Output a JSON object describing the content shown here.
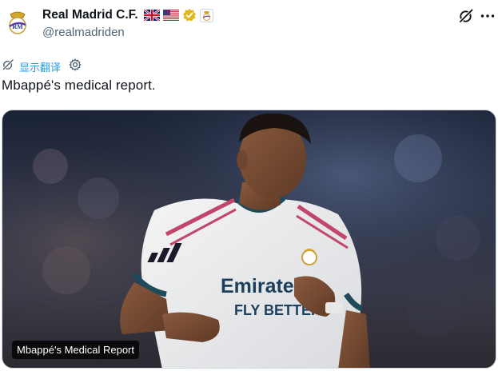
{
  "post": {
    "author": {
      "display_name": "Real Madrid C.F.",
      "handle": "@realmadriden",
      "avatar_icon": "real-madrid-crest-icon",
      "badges": [
        "uk-flag-icon",
        "us-flag-icon",
        "gold-verified-icon",
        "affiliate-crest-icon"
      ]
    },
    "translate": {
      "label": "显示翻译"
    },
    "text": "Mbappé's medical report.",
    "media": {
      "caption": "Mbappé's Medical Report"
    }
  },
  "colors": {
    "link_blue": "#1d9bf0",
    "handle_grey": "#536471",
    "verified_gold": "#e2b719"
  }
}
